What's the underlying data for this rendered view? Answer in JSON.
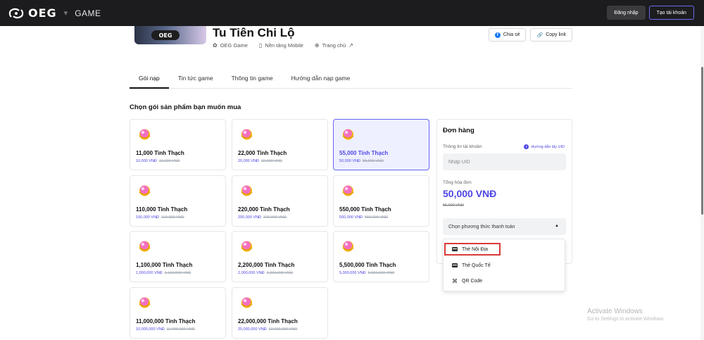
{
  "topbar": {
    "logo_text": "OEG",
    "section": "GAME",
    "login_label": "Đăng nhập",
    "signup_label": "Tạo tài khoản"
  },
  "game": {
    "banner_logo": "OEG",
    "title": "Tu Tiên Chi Lộ",
    "publisher": "OEG Game",
    "platform": "Nền tảng Mobile",
    "homepage": "Trang chủ",
    "share_label": "Chia sẻ",
    "copy_label": "Copy link"
  },
  "tabs": [
    {
      "label": "Gói nạp",
      "active": true
    },
    {
      "label": "Tin tức game",
      "active": false
    },
    {
      "label": "Thông tin game",
      "active": false
    },
    {
      "label": "Hướng dẫn nạp game",
      "active": false
    }
  ],
  "section_title": "Chọn gói sản phẩm bạn muốn mua",
  "packages": [
    {
      "name": "11,000 Tinh Thạch",
      "price": "10,000 VNĐ",
      "old_price": "11,000 VNĐ"
    },
    {
      "name": "22,000 Tinh Thạch",
      "price": "20,000 VNĐ",
      "old_price": "22,000 VNĐ"
    },
    {
      "name": "55,000 Tinh Thạch",
      "price": "50,000 VNĐ",
      "old_price": "55,000 VNĐ",
      "selected": true
    },
    {
      "name": "110,000 Tinh Thạch",
      "price": "100,000 VNĐ",
      "old_price": "110,000 VNĐ"
    },
    {
      "name": "220,000 Tinh Thạch",
      "price": "200,000 VNĐ",
      "old_price": "220,000 VNĐ"
    },
    {
      "name": "550,000 Tinh Thạch",
      "price": "500,000 VNĐ",
      "old_price": "550,000 VNĐ"
    },
    {
      "name": "1,100,000 Tinh Thạch",
      "price": "1,000,000 VNĐ",
      "old_price": "1,100,000 VNĐ"
    },
    {
      "name": "2,200,000 Tinh Thạch",
      "price": "2,000,000 VNĐ",
      "old_price": "2,200,000 VNĐ"
    },
    {
      "name": "5,500,000 Tinh Thạch",
      "price": "5,000,000 VNĐ",
      "old_price": "5,500,000 VNĐ"
    },
    {
      "name": "11,000,000 Tinh Thạch",
      "price": "10,000,000 VNĐ",
      "old_price": "11,000,000 VNĐ"
    },
    {
      "name": "22,000,000 Tinh Thạch",
      "price": "20,000,000 VNĐ",
      "old_price": "22,000,000 VNĐ"
    }
  ],
  "order": {
    "title": "Đơn hàng",
    "account_label": "Thông tin tài khoản",
    "uid_help": "Hướng dẫn lấy UID",
    "uid_placeholder": "Nhập UID",
    "total_label": "Tổng hóa đơn",
    "total_value": "50,000 VNĐ",
    "total_old": "55,000 VNĐ",
    "payment_placeholder": "Chọn phương thức thanh toán"
  },
  "payment_options": [
    {
      "label": "Thẻ Nội Địa",
      "icon": "credit-card-icon"
    },
    {
      "label": "Thẻ Quốc Tế",
      "icon": "credit-card-icon"
    },
    {
      "label": "QR Code",
      "icon": "qr-code-icon"
    }
  ],
  "watermark": {
    "title": "Activate Windows",
    "subtitle": "Go to Settings to activate Windows."
  },
  "colors": {
    "accent": "#4f46e5",
    "topbar": "#1c1c1e",
    "highlight_border": "#d93a3a"
  }
}
